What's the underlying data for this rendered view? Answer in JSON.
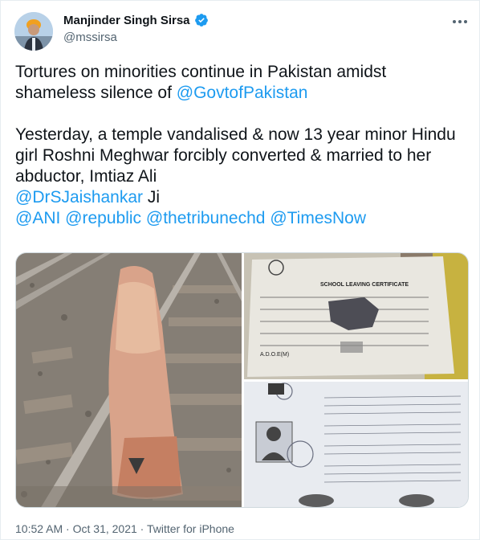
{
  "author": {
    "name": "Manjinder Singh Sirsa",
    "handle": "@mssirsa"
  },
  "tweet": {
    "line1": "Tortures on minorities continue in Pakistan amidst shameless silence of ",
    "mention_govt": "@GovtofPakistan",
    "line2": "Yesterday, a temple vandalised & now 13 year minor Hindu girl Roshni Meghwar forcibly converted & married to her abductor, Imtiaz Ali",
    "mention_jaishankar": "@DrSJaishankar",
    "ji": " Ji",
    "mentions": [
      "@ANI",
      "@republic",
      "@thetribunechd",
      "@TimesNow"
    ]
  },
  "media": {
    "certificate_title": "SCHOOL LEAVING CERTIFICATE",
    "certificate_footer": "A.D.O.E(M)"
  },
  "meta": {
    "time": "10:52 AM",
    "date": "Oct 31, 2021",
    "source": "Twitter for iPhone",
    "separator": " · "
  },
  "colors": {
    "link": "#1d9bf0",
    "text": "#0f1419",
    "muted": "#536471"
  }
}
